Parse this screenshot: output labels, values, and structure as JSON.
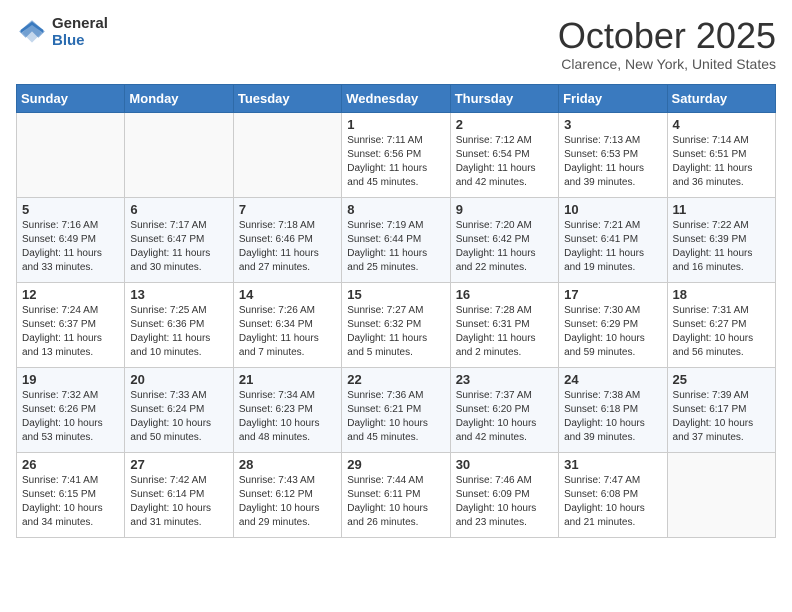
{
  "logo": {
    "general": "General",
    "blue": "Blue"
  },
  "title": "October 2025",
  "location": "Clarence, New York, United States",
  "weekdays": [
    "Sunday",
    "Monday",
    "Tuesday",
    "Wednesday",
    "Thursday",
    "Friday",
    "Saturday"
  ],
  "weeks": [
    [
      {
        "day": "",
        "info": ""
      },
      {
        "day": "",
        "info": ""
      },
      {
        "day": "",
        "info": ""
      },
      {
        "day": "1",
        "info": "Sunrise: 7:11 AM\nSunset: 6:56 PM\nDaylight: 11 hours and 45 minutes."
      },
      {
        "day": "2",
        "info": "Sunrise: 7:12 AM\nSunset: 6:54 PM\nDaylight: 11 hours and 42 minutes."
      },
      {
        "day": "3",
        "info": "Sunrise: 7:13 AM\nSunset: 6:53 PM\nDaylight: 11 hours and 39 minutes."
      },
      {
        "day": "4",
        "info": "Sunrise: 7:14 AM\nSunset: 6:51 PM\nDaylight: 11 hours and 36 minutes."
      }
    ],
    [
      {
        "day": "5",
        "info": "Sunrise: 7:16 AM\nSunset: 6:49 PM\nDaylight: 11 hours and 33 minutes."
      },
      {
        "day": "6",
        "info": "Sunrise: 7:17 AM\nSunset: 6:47 PM\nDaylight: 11 hours and 30 minutes."
      },
      {
        "day": "7",
        "info": "Sunrise: 7:18 AM\nSunset: 6:46 PM\nDaylight: 11 hours and 27 minutes."
      },
      {
        "day": "8",
        "info": "Sunrise: 7:19 AM\nSunset: 6:44 PM\nDaylight: 11 hours and 25 minutes."
      },
      {
        "day": "9",
        "info": "Sunrise: 7:20 AM\nSunset: 6:42 PM\nDaylight: 11 hours and 22 minutes."
      },
      {
        "day": "10",
        "info": "Sunrise: 7:21 AM\nSunset: 6:41 PM\nDaylight: 11 hours and 19 minutes."
      },
      {
        "day": "11",
        "info": "Sunrise: 7:22 AM\nSunset: 6:39 PM\nDaylight: 11 hours and 16 minutes."
      }
    ],
    [
      {
        "day": "12",
        "info": "Sunrise: 7:24 AM\nSunset: 6:37 PM\nDaylight: 11 hours and 13 minutes."
      },
      {
        "day": "13",
        "info": "Sunrise: 7:25 AM\nSunset: 6:36 PM\nDaylight: 11 hours and 10 minutes."
      },
      {
        "day": "14",
        "info": "Sunrise: 7:26 AM\nSunset: 6:34 PM\nDaylight: 11 hours and 7 minutes."
      },
      {
        "day": "15",
        "info": "Sunrise: 7:27 AM\nSunset: 6:32 PM\nDaylight: 11 hours and 5 minutes."
      },
      {
        "day": "16",
        "info": "Sunrise: 7:28 AM\nSunset: 6:31 PM\nDaylight: 11 hours and 2 minutes."
      },
      {
        "day": "17",
        "info": "Sunrise: 7:30 AM\nSunset: 6:29 PM\nDaylight: 10 hours and 59 minutes."
      },
      {
        "day": "18",
        "info": "Sunrise: 7:31 AM\nSunset: 6:27 PM\nDaylight: 10 hours and 56 minutes."
      }
    ],
    [
      {
        "day": "19",
        "info": "Sunrise: 7:32 AM\nSunset: 6:26 PM\nDaylight: 10 hours and 53 minutes."
      },
      {
        "day": "20",
        "info": "Sunrise: 7:33 AM\nSunset: 6:24 PM\nDaylight: 10 hours and 50 minutes."
      },
      {
        "day": "21",
        "info": "Sunrise: 7:34 AM\nSunset: 6:23 PM\nDaylight: 10 hours and 48 minutes."
      },
      {
        "day": "22",
        "info": "Sunrise: 7:36 AM\nSunset: 6:21 PM\nDaylight: 10 hours and 45 minutes."
      },
      {
        "day": "23",
        "info": "Sunrise: 7:37 AM\nSunset: 6:20 PM\nDaylight: 10 hours and 42 minutes."
      },
      {
        "day": "24",
        "info": "Sunrise: 7:38 AM\nSunset: 6:18 PM\nDaylight: 10 hours and 39 minutes."
      },
      {
        "day": "25",
        "info": "Sunrise: 7:39 AM\nSunset: 6:17 PM\nDaylight: 10 hours and 37 minutes."
      }
    ],
    [
      {
        "day": "26",
        "info": "Sunrise: 7:41 AM\nSunset: 6:15 PM\nDaylight: 10 hours and 34 minutes."
      },
      {
        "day": "27",
        "info": "Sunrise: 7:42 AM\nSunset: 6:14 PM\nDaylight: 10 hours and 31 minutes."
      },
      {
        "day": "28",
        "info": "Sunrise: 7:43 AM\nSunset: 6:12 PM\nDaylight: 10 hours and 29 minutes."
      },
      {
        "day": "29",
        "info": "Sunrise: 7:44 AM\nSunset: 6:11 PM\nDaylight: 10 hours and 26 minutes."
      },
      {
        "day": "30",
        "info": "Sunrise: 7:46 AM\nSunset: 6:09 PM\nDaylight: 10 hours and 23 minutes."
      },
      {
        "day": "31",
        "info": "Sunrise: 7:47 AM\nSunset: 6:08 PM\nDaylight: 10 hours and 21 minutes."
      },
      {
        "day": "",
        "info": ""
      }
    ]
  ]
}
